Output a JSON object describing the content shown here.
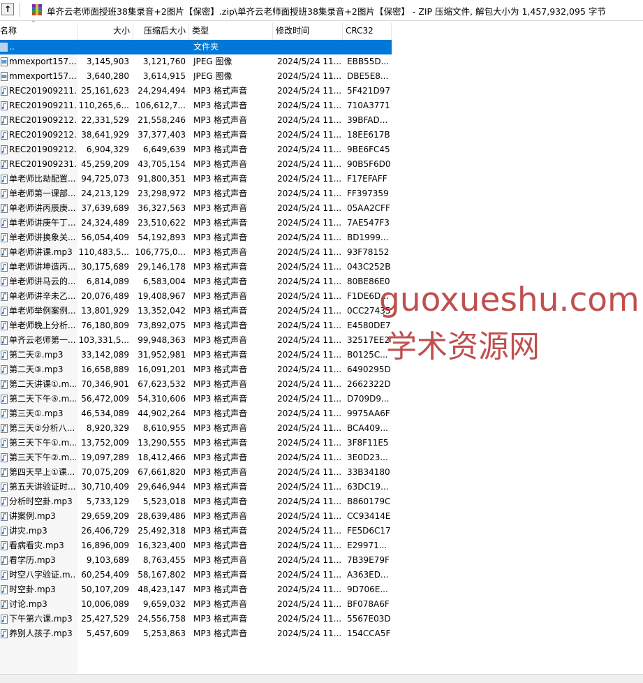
{
  "path": {
    "text": "单齐云老师面授班38集录音+2图片【保密】.zip\\单齐云老师面授班38集录音+2图片【保密】 - ZIP 压缩文件, 解包大小为 1,457,932,095 字节"
  },
  "columns": {
    "name": "名称",
    "size": "大小",
    "packed": "压缩后大小",
    "type": "类型",
    "modified": "修改时间",
    "crc": "CRC32"
  },
  "parent_row": {
    "name": "..",
    "type": "文件夹"
  },
  "icons": {
    "up": "up-folder-icon",
    "archive": "zip-archive-icon",
    "image": "image-file-icon",
    "audio": "audio-file-icon"
  },
  "colors": {
    "selection": "#0078d7",
    "watermark": "#b22a2a"
  },
  "files": [
    {
      "name": "mmexport157...",
      "size": "3,145,903",
      "packed": "3,121,760",
      "type": "JPEG 图像",
      "modified": "2024/5/24 11...",
      "crc": "EBB55D...",
      "icon": "image"
    },
    {
      "name": "mmexport157...",
      "size": "3,640,280",
      "packed": "3,614,915",
      "type": "JPEG 图像",
      "modified": "2024/5/24 11...",
      "crc": "DBE5E8...",
      "icon": "image"
    },
    {
      "name": "REC201909211...",
      "size": "25,161,623",
      "packed": "24,294,494",
      "type": "MP3 格式声音",
      "modified": "2024/5/24 11...",
      "crc": "5F421D97",
      "icon": "audio"
    },
    {
      "name": "REC201909211...",
      "size": "110,265,6...",
      "packed": "106,612,7...",
      "type": "MP3 格式声音",
      "modified": "2024/5/24 11...",
      "crc": "710A3771",
      "icon": "audio"
    },
    {
      "name": "REC201909212...",
      "size": "22,331,529",
      "packed": "21,558,246",
      "type": "MP3 格式声音",
      "modified": "2024/5/24 11...",
      "crc": "39BFAD...",
      "icon": "audio"
    },
    {
      "name": "REC201909212...",
      "size": "38,641,929",
      "packed": "37,377,403",
      "type": "MP3 格式声音",
      "modified": "2024/5/24 11...",
      "crc": "18EE617B",
      "icon": "audio"
    },
    {
      "name": "REC201909212...",
      "size": "6,904,329",
      "packed": "6,649,639",
      "type": "MP3 格式声音",
      "modified": "2024/5/24 11...",
      "crc": "9BE6FC45",
      "icon": "audio"
    },
    {
      "name": "REC201909231...",
      "size": "45,259,209",
      "packed": "43,705,154",
      "type": "MP3 格式声音",
      "modified": "2024/5/24 11...",
      "crc": "90B5F6D0",
      "icon": "audio"
    },
    {
      "name": "单老师比劫配置...",
      "size": "94,725,073",
      "packed": "91,800,351",
      "type": "MP3 格式声音",
      "modified": "2024/5/24 11...",
      "crc": "F17EFAFF",
      "icon": "audio"
    },
    {
      "name": "单老师第一课部...",
      "size": "24,213,129",
      "packed": "23,298,972",
      "type": "MP3 格式声音",
      "modified": "2024/5/24 11...",
      "crc": "FF397359",
      "icon": "audio"
    },
    {
      "name": "单老师讲丙辰庚...",
      "size": "37,639,689",
      "packed": "36,327,563",
      "type": "MP3 格式声音",
      "modified": "2024/5/24 11...",
      "crc": "05AA2CFF",
      "icon": "audio"
    },
    {
      "name": "单老师讲庚午丁...",
      "size": "24,324,489",
      "packed": "23,510,622",
      "type": "MP3 格式声音",
      "modified": "2024/5/24 11...",
      "crc": "7AE547F3",
      "icon": "audio"
    },
    {
      "name": "单老师讲换象关...",
      "size": "56,054,409",
      "packed": "54,192,893",
      "type": "MP3 格式声音",
      "modified": "2024/5/24 11...",
      "crc": "BD1999...",
      "icon": "audio"
    },
    {
      "name": "单老师讲课.mp3",
      "size": "110,483,5...",
      "packed": "106,775,0...",
      "type": "MP3 格式声音",
      "modified": "2024/5/24 11...",
      "crc": "93F78152",
      "icon": "audio"
    },
    {
      "name": "单老师讲坤造丙...",
      "size": "30,175,689",
      "packed": "29,146,178",
      "type": "MP3 格式声音",
      "modified": "2024/5/24 11...",
      "crc": "043C252B",
      "icon": "audio"
    },
    {
      "name": "单老师讲马云的...",
      "size": "6,814,089",
      "packed": "6,583,004",
      "type": "MP3 格式声音",
      "modified": "2024/5/24 11...",
      "crc": "80BE86E0",
      "icon": "audio"
    },
    {
      "name": "单老师讲辛未乙...",
      "size": "20,076,489",
      "packed": "19,408,967",
      "type": "MP3 格式声音",
      "modified": "2024/5/24 11...",
      "crc": "F1DE6D...",
      "icon": "audio"
    },
    {
      "name": "单老师举例案例...",
      "size": "13,801,929",
      "packed": "13,352,042",
      "type": "MP3 格式声音",
      "modified": "2024/5/24 11...",
      "crc": "0CC27435",
      "icon": "audio"
    },
    {
      "name": "单老师晚上分析...",
      "size": "76,180,809",
      "packed": "73,892,075",
      "type": "MP3 格式声音",
      "modified": "2024/5/24 11...",
      "crc": "E4580DE7",
      "icon": "audio"
    },
    {
      "name": "单齐云老师第一...",
      "size": "103,331,5...",
      "packed": "99,948,363",
      "type": "MP3 格式声音",
      "modified": "2024/5/24 11...",
      "crc": "32517EE2",
      "icon": "audio"
    },
    {
      "name": "第二天②.mp3",
      "size": "33,142,089",
      "packed": "31,952,981",
      "type": "MP3 格式声音",
      "modified": "2024/5/24 11...",
      "crc": "B0125C...",
      "icon": "audio"
    },
    {
      "name": "第二天③.mp3",
      "size": "16,658,889",
      "packed": "16,091,201",
      "type": "MP3 格式声音",
      "modified": "2024/5/24 11...",
      "crc": "6490295D",
      "icon": "audio"
    },
    {
      "name": "第二天讲课①.m...",
      "size": "70,346,901",
      "packed": "67,623,532",
      "type": "MP3 格式声音",
      "modified": "2024/5/24 11...",
      "crc": "2662322D",
      "icon": "audio"
    },
    {
      "name": "第二天下午⑤.m...",
      "size": "56,472,009",
      "packed": "54,310,606",
      "type": "MP3 格式声音",
      "modified": "2024/5/24 11...",
      "crc": "D709D9...",
      "icon": "audio"
    },
    {
      "name": "第三天①.mp3",
      "size": "46,534,089",
      "packed": "44,902,264",
      "type": "MP3 格式声音",
      "modified": "2024/5/24 11...",
      "crc": "9975AA6F",
      "icon": "audio"
    },
    {
      "name": "第三天②分析八...",
      "size": "8,920,329",
      "packed": "8,610,955",
      "type": "MP3 格式声音",
      "modified": "2024/5/24 11...",
      "crc": "BCA409...",
      "icon": "audio"
    },
    {
      "name": "第三天下午①.m...",
      "size": "13,752,009",
      "packed": "13,290,555",
      "type": "MP3 格式声音",
      "modified": "2024/5/24 11...",
      "crc": "3F8F11E5",
      "icon": "audio"
    },
    {
      "name": "第三天下午②.m...",
      "size": "19,097,289",
      "packed": "18,412,466",
      "type": "MP3 格式声音",
      "modified": "2024/5/24 11...",
      "crc": "3E0D23...",
      "icon": "audio"
    },
    {
      "name": "第四天早上①课...",
      "size": "70,075,209",
      "packed": "67,661,820",
      "type": "MP3 格式声音",
      "modified": "2024/5/24 11...",
      "crc": "33B34180",
      "icon": "audio"
    },
    {
      "name": "第五天讲验证时...",
      "size": "30,710,409",
      "packed": "29,646,944",
      "type": "MP3 格式声音",
      "modified": "2024/5/24 11...",
      "crc": "63DC19...",
      "icon": "audio"
    },
    {
      "name": "分析时空卦.mp3",
      "size": "5,733,129",
      "packed": "5,523,018",
      "type": "MP3 格式声音",
      "modified": "2024/5/24 11...",
      "crc": "B860179C",
      "icon": "audio"
    },
    {
      "name": "讲案例.mp3",
      "size": "29,659,209",
      "packed": "28,639,486",
      "type": "MP3 格式声音",
      "modified": "2024/5/24 11...",
      "crc": "CC93414E",
      "icon": "audio"
    },
    {
      "name": "讲灾.mp3",
      "size": "26,406,729",
      "packed": "25,492,318",
      "type": "MP3 格式声音",
      "modified": "2024/5/24 11...",
      "crc": "FE5D6C17",
      "icon": "audio"
    },
    {
      "name": "看病看灾.mp3",
      "size": "16,896,009",
      "packed": "16,323,400",
      "type": "MP3 格式声音",
      "modified": "2024/5/24 11...",
      "crc": "E29971...",
      "icon": "audio"
    },
    {
      "name": "看学历.mp3",
      "size": "9,103,689",
      "packed": "8,763,455",
      "type": "MP3 格式声音",
      "modified": "2024/5/24 11...",
      "crc": "7B39E79F",
      "icon": "audio"
    },
    {
      "name": "时空八字验证.m...",
      "size": "60,254,409",
      "packed": "58,167,802",
      "type": "MP3 格式声音",
      "modified": "2024/5/24 11...",
      "crc": "A363ED...",
      "icon": "audio"
    },
    {
      "name": "时空卦.mp3",
      "size": "50,107,209",
      "packed": "48,423,147",
      "type": "MP3 格式声音",
      "modified": "2024/5/24 11...",
      "crc": "9D706E...",
      "icon": "audio"
    },
    {
      "name": "讨论.mp3",
      "size": "10,006,089",
      "packed": "9,659,032",
      "type": "MP3 格式声音",
      "modified": "2024/5/24 11...",
      "crc": "BF078A6F",
      "icon": "audio"
    },
    {
      "name": "下午第六课.mp3",
      "size": "25,427,529",
      "packed": "24,556,758",
      "type": "MP3 格式声音",
      "modified": "2024/5/24 11...",
      "crc": "5567E03D",
      "icon": "audio"
    },
    {
      "name": "养别人孩子.mp3",
      "size": "5,457,609",
      "packed": "5,253,863",
      "type": "MP3 格式声音",
      "modified": "2024/5/24 11...",
      "crc": "154CCA5F",
      "icon": "audio"
    }
  ],
  "watermark": {
    "line1": "guoxueshu.com",
    "line2": "学术资源网"
  }
}
